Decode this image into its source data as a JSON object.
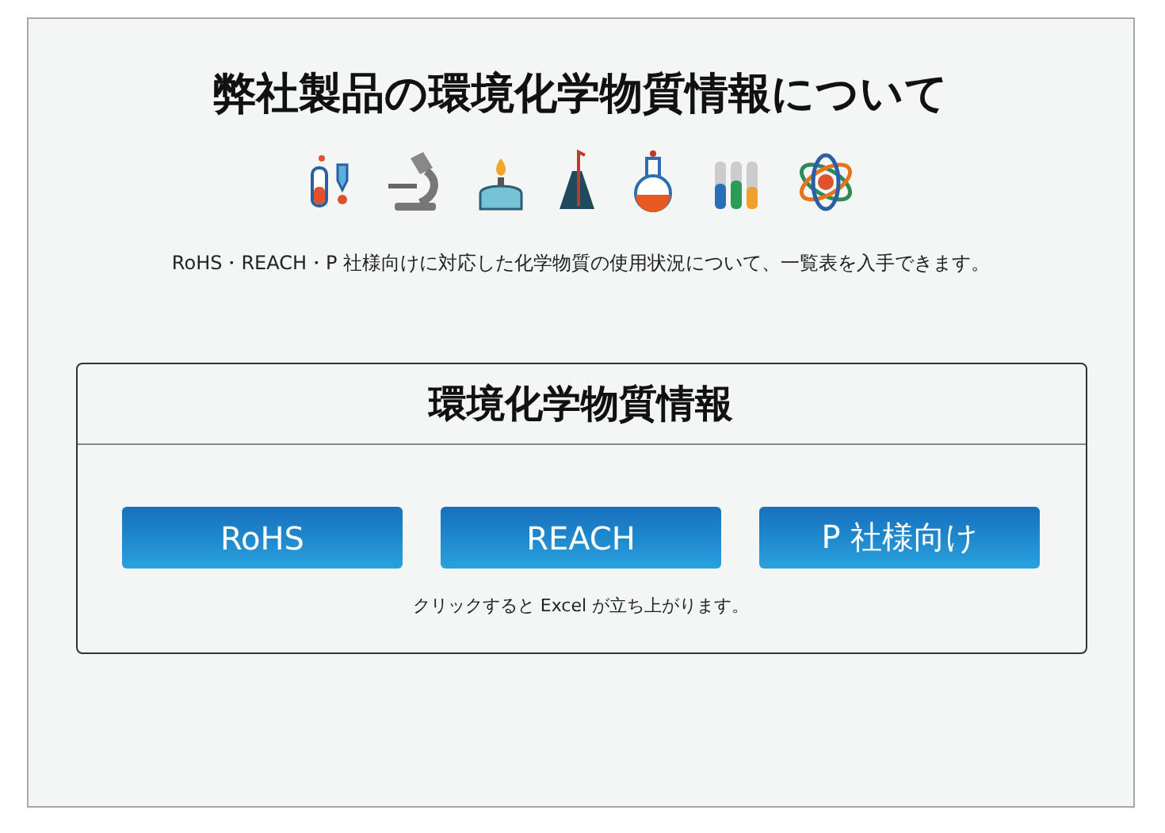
{
  "heading": "弊社製品の環境化学物質情報について",
  "description": "RoHS・REACH・P 社様向けに対応した化学物質の使用状況について、一覧表を入手できます。",
  "panel": {
    "title": "環境化学物質情報",
    "buttons": [
      "RoHS",
      "REACH",
      "P 社様向け"
    ],
    "note": "クリックすると Excel が立ち上がります。"
  }
}
